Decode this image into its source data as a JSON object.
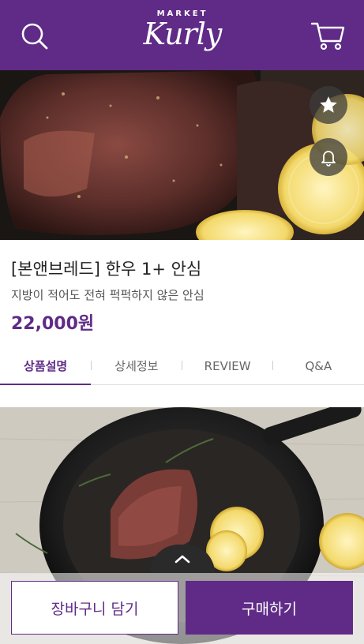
{
  "header": {
    "logo_top": "MARKET",
    "logo_main": "Kurly",
    "search_icon": "search-icon",
    "cart_icon": "cart-icon",
    "bg_color": "#5f2b87"
  },
  "hero": {
    "star_icon": "star-icon",
    "bell_icon": "bell-icon"
  },
  "product": {
    "title": "[본앤브레드] 한우 1+ 안심",
    "subtitle": "지방이 적어도 전혀 퍽퍽하지 않은 안심",
    "price": "22,000원"
  },
  "tabs": [
    {
      "label": "상품설명",
      "active": true
    },
    {
      "label": "상세정보",
      "active": false
    },
    {
      "label": "REVIEW",
      "active": false
    },
    {
      "label": "Q&A",
      "active": false
    }
  ],
  "bottom": {
    "cart_button": "장바구니 담기",
    "buy_button": "구매하기",
    "up_icon": "chevron-up-icon"
  },
  "colors": {
    "accent": "#5f2b87"
  }
}
